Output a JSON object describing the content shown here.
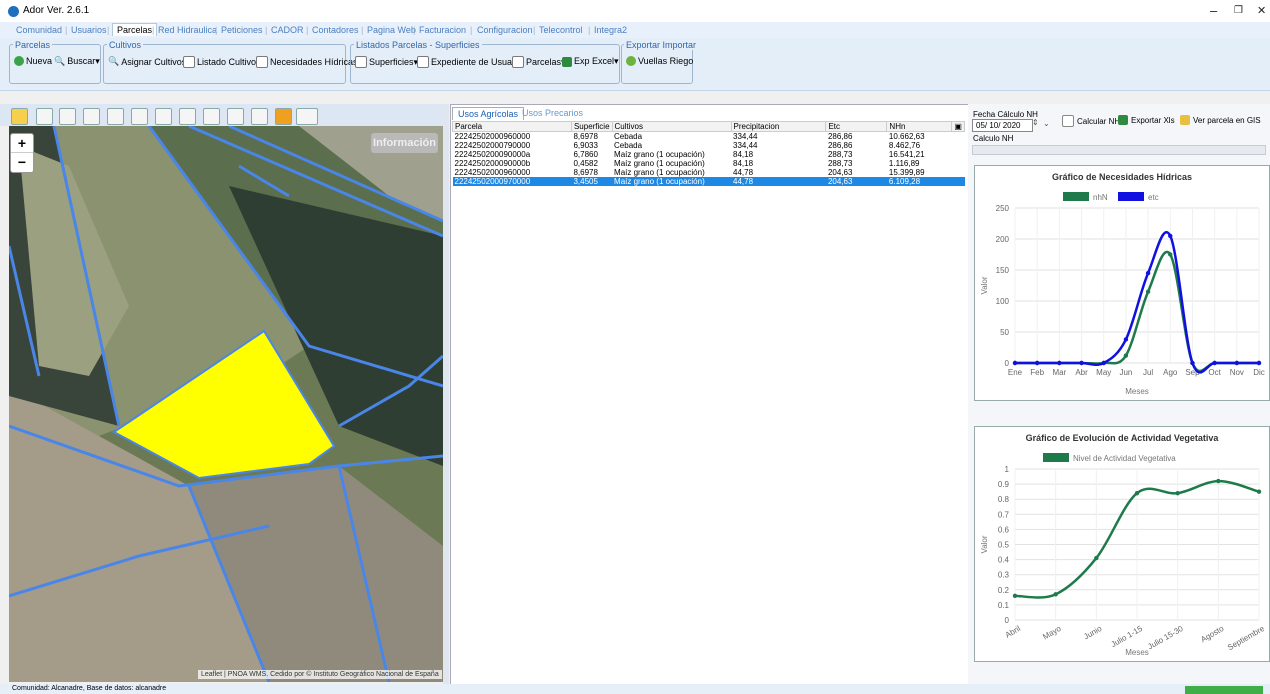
{
  "window": {
    "title": "Ador Ver. 2.6.1",
    "minimize": "–",
    "restore": "❐",
    "close": "✕"
  },
  "menu": [
    "Comunidad",
    "Usuarios",
    "Parcelas",
    "Red Hidraulica",
    "Peticiones",
    "CADOR",
    "Contadores",
    "Pagina Web",
    "Facturacion",
    "Configuracion",
    "Telecontrol",
    "Integra2"
  ],
  "menu_active": "Parcelas",
  "ribbon": {
    "parcelas": {
      "label": "Parcelas",
      "nueva": "Nueva",
      "buscar": "Buscar▾"
    },
    "cultivos": {
      "label": "Cultivos",
      "asignar": "Asignar Cultivos",
      "listado": "Listado Cultivos",
      "necesidades": "Necesidades Hídricas"
    },
    "listados": {
      "label": "Listados Parcelas - Superficies",
      "superficies": "Superficies▾",
      "expediente": "Expediente de Usuario",
      "parcelas": "Parcelas▾",
      "exp_excel": "Exp Excel▾"
    },
    "exportar": {
      "label": "Exportar Importar",
      "vuellas": "Vuellas Riego"
    }
  },
  "map": {
    "info": "Información",
    "zoom_in": "+",
    "zoom_out": "−",
    "attribution": "Leaflet | PNOA WMS. Cedido por © Instituto Geográfico Nacional de España"
  },
  "tabs": [
    "Usos Agrícolas",
    "Usos Precarios"
  ],
  "table": {
    "columns": [
      "Parcela",
      "Superficie",
      "Cultivos",
      "Precipitacion",
      "Etc",
      "NHn"
    ],
    "rows": [
      [
        "22242502000960000",
        "8,6978",
        "Cebada",
        "334,44",
        "286,86",
        "10.662,63"
      ],
      [
        "22242502000790000",
        "6,9033",
        "Cebada",
        "334,44",
        "286,86",
        "8.462,76"
      ],
      [
        "2224250200090000a",
        "6,7860",
        "Maíz grano (1 ocupación)",
        "84,18",
        "288,73",
        "16.541,21"
      ],
      [
        "2224250200090000b",
        "0,4582",
        "Maíz grano (1 ocupación)",
        "84,18",
        "288,73",
        "1.116,89"
      ],
      [
        "22242502000960000",
        "8,6978",
        "Maíz grano (1 ocupación)",
        "44,78",
        "204,63",
        "15.399,89"
      ],
      [
        "22242502000970000",
        "3,4505",
        "Maíz grano (1 ocupación)",
        "44,78",
        "204,63",
        "6.109,28"
      ]
    ],
    "selected_row": 5
  },
  "right": {
    "fecha_label": "Fecha Cálculo NH",
    "fecha_value": "05/ 10/  2020",
    "calcular": "Calcular NH",
    "exportar": "Exportar Xls",
    "ver_gis": "Ver parcela en GIS",
    "calculo_label": "Calculo NH"
  },
  "status": {
    "text": "Comunidad: Alcanadre, Base de datos: alcanadre"
  },
  "chart_data": [
    {
      "type": "line",
      "title": "Gráfico de Necesidades Hídricas",
      "xlabel": "Meses",
      "ylabel": "Valor",
      "categories": [
        "Ene",
        "Feb",
        "Mar",
        "Abr",
        "May",
        "Jun",
        "Jul",
        "Ago",
        "Sep",
        "Oct",
        "Nov",
        "Dic"
      ],
      "ylim": [
        0,
        250
      ],
      "yticks": [
        0,
        50,
        100,
        150,
        200,
        250
      ],
      "series": [
        {
          "name": "nhN",
          "color": "#1e7a4a",
          "values": [
            0,
            0,
            0,
            0,
            0,
            12,
            115,
            175,
            0,
            0,
            0,
            0
          ]
        },
        {
          "name": "etc",
          "color": "#1010e0",
          "values": [
            0,
            0,
            0,
            0,
            0,
            38,
            145,
            205,
            0,
            0,
            0,
            0
          ]
        }
      ],
      "legend": "top"
    },
    {
      "type": "line",
      "title": "Gráfico de Evolución de Actividad Vegetativa",
      "xlabel": "Meses",
      "ylabel": "Valor",
      "categories": [
        "Abril",
        "Mayo",
        "Junio",
        "Julio 1-15",
        "Julio 15-30",
        "Agosto",
        "Septiembre"
      ],
      "ylim": [
        0,
        1.0
      ],
      "yticks": [
        0,
        0.1,
        0.2,
        0.3,
        0.4,
        0.5,
        0.6,
        0.7,
        0.8,
        0.9,
        1.0
      ],
      "series": [
        {
          "name": "Nivel de Actividad Vegetativa",
          "color": "#1e7a4a",
          "values": [
            0.16,
            0.17,
            0.41,
            0.84,
            0.84,
            0.92,
            0.85
          ]
        }
      ],
      "legend": "top"
    }
  ]
}
